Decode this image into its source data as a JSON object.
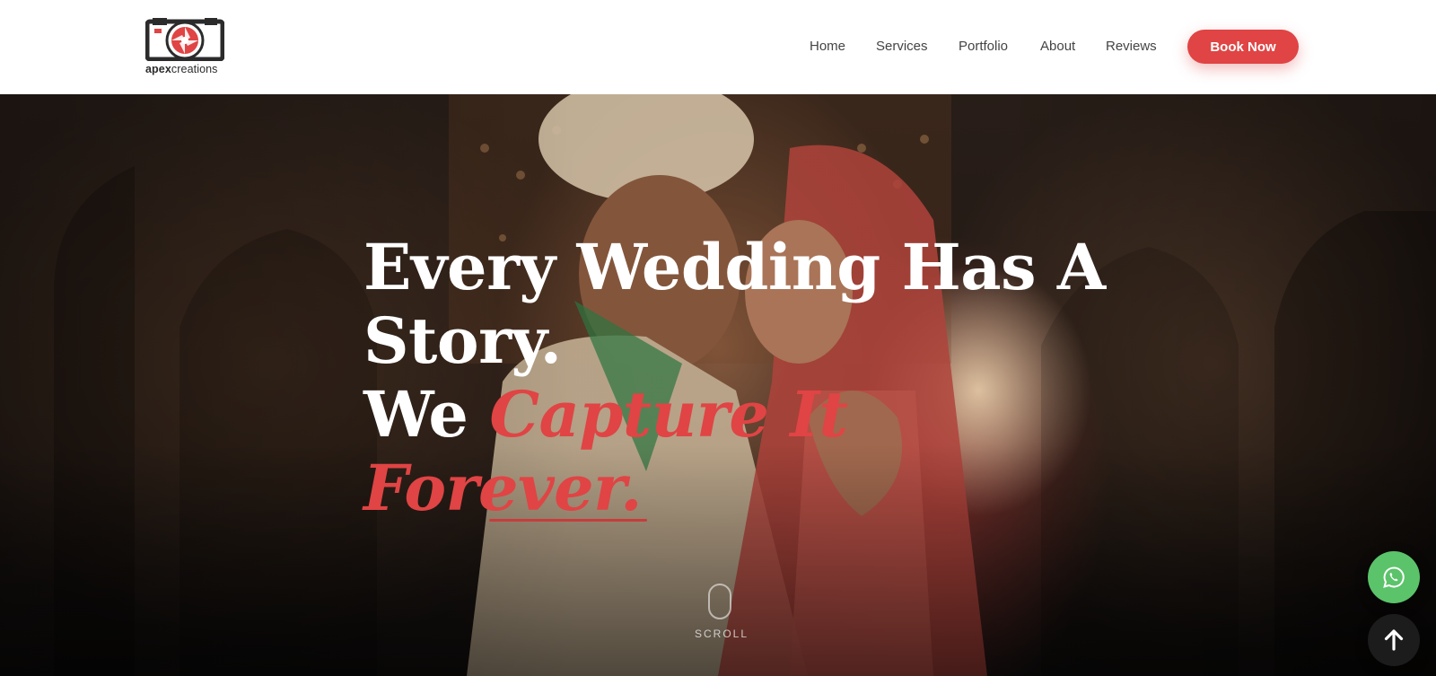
{
  "brand": {
    "logo_bold": "apex",
    "logo_light": "creations",
    "accent_color": "#e04444"
  },
  "nav": {
    "items": [
      {
        "label": "Home"
      },
      {
        "label": "Services"
      },
      {
        "label": "Portfolio"
      },
      {
        "label": "About"
      },
      {
        "label": "Reviews"
      }
    ],
    "cta_label": "Book Now"
  },
  "hero": {
    "line1": "Every Wedding Has A",
    "line2": "Story.",
    "line3_plain": "We ",
    "line3_accent": "Capture It",
    "line4_accent": "Forever.",
    "scroll_label": "SCROLL"
  },
  "floating": {
    "whatsapp_icon": "whatsapp-icon",
    "top_icon": "arrow-up-icon"
  }
}
